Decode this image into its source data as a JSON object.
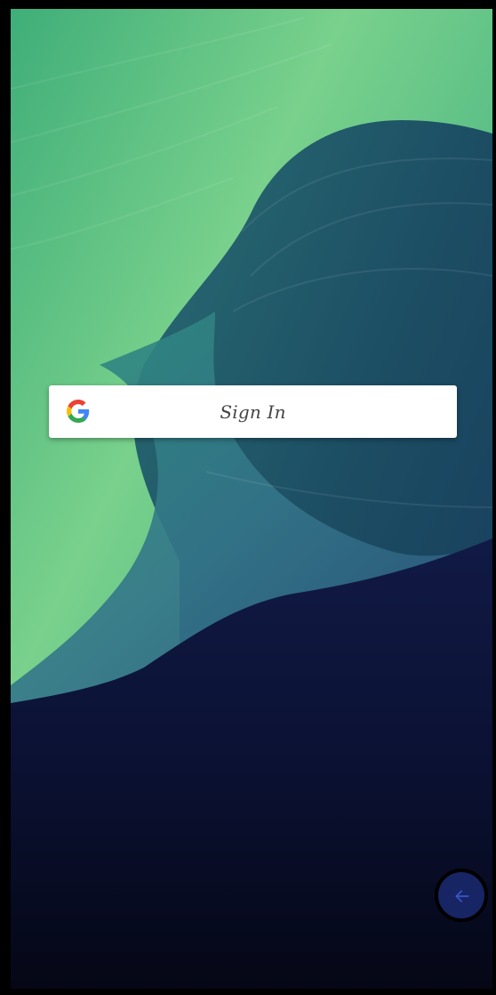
{
  "signin": {
    "label": "Sign In",
    "icon": "google-icon"
  },
  "fab": {
    "icon": "arrow-left-icon"
  }
}
